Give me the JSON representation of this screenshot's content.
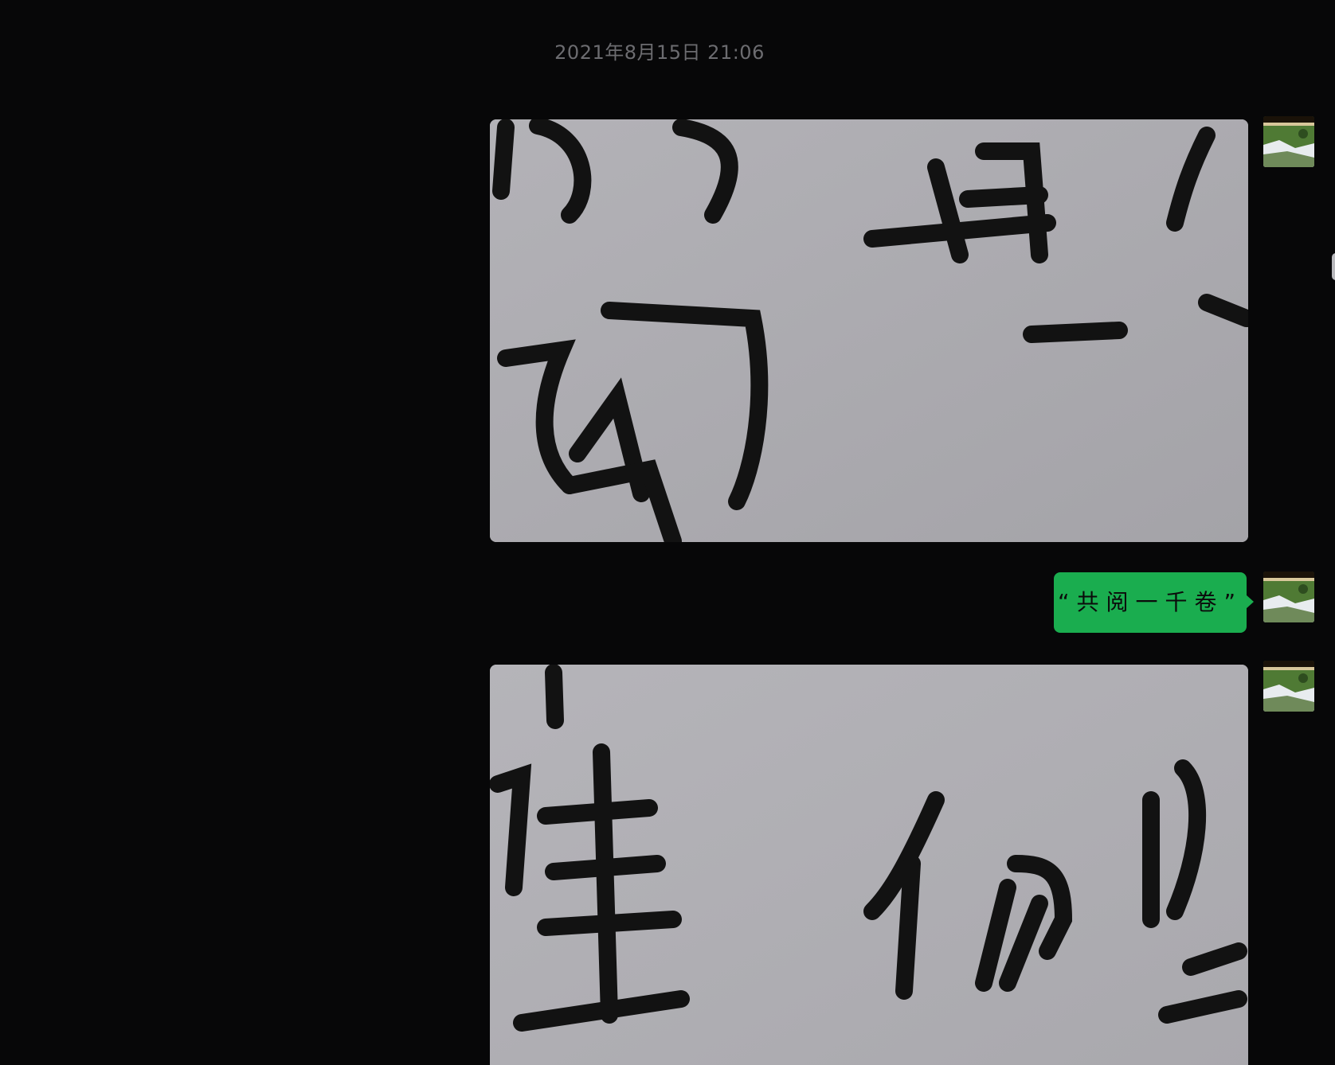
{
  "chat": {
    "timestamp": "2021年8月15日 21:06",
    "messages": [
      {
        "type": "image",
        "description_icon": "calligraphy-photo",
        "avatar_icon": "landscape-avatar-icon"
      },
      {
        "type": "text",
        "text": "“共阅一千卷”",
        "avatar_icon": "landscape-avatar-icon"
      },
      {
        "type": "image",
        "description_icon": "calligraphy-photo",
        "avatar_icon": "landscape-avatar-icon"
      }
    ]
  },
  "colors": {
    "background": "#070708",
    "bubble": "#1aad4f",
    "timestamp": "#6c6c70",
    "paper": "#a9a8ad"
  }
}
